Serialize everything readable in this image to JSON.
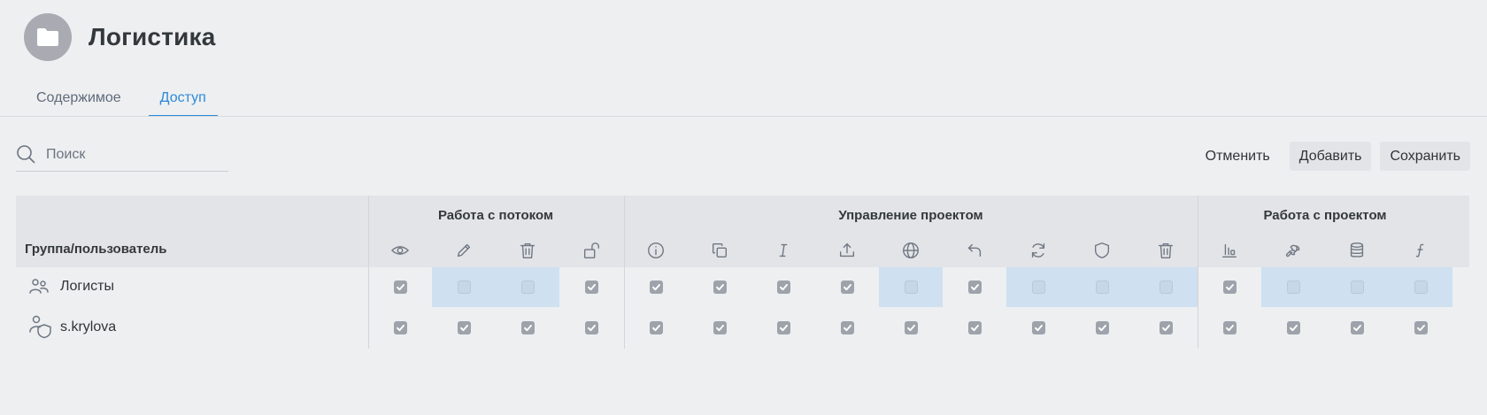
{
  "header": {
    "title": "Логистика",
    "icon": "folder-icon"
  },
  "tabs": [
    {
      "label": "Содержимое",
      "active": false
    },
    {
      "label": "Доступ",
      "active": true
    }
  ],
  "search": {
    "placeholder": "Поиск",
    "value": ""
  },
  "actions": {
    "cancel": "Отменить",
    "add": "Добавить",
    "save": "Сохранить"
  },
  "table": {
    "user_column": "Группа/пользователь",
    "groups": [
      {
        "title": "Работа с потоком",
        "icons": [
          "eye-icon",
          "pencil-icon",
          "trash-icon",
          "unlock-icon"
        ]
      },
      {
        "title": "Управление проектом",
        "icons": [
          "info-icon",
          "copy-icon",
          "italic-icon",
          "upload-icon",
          "globe-icon",
          "undo-icon",
          "refresh-icon",
          "shield-icon",
          "trash-icon"
        ]
      },
      {
        "title": "Работа с проектом",
        "icons": [
          "bar-chart-icon",
          "wrench-icon",
          "database-icon",
          "function-icon"
        ]
      }
    ],
    "rows": [
      {
        "name": "Логисты",
        "icon": "group-users-icon",
        "perms": [
          true,
          false,
          false,
          true,
          true,
          true,
          true,
          true,
          false,
          true,
          false,
          false,
          false,
          true,
          false,
          false,
          false
        ]
      },
      {
        "name": "s.krylova",
        "icon": "user-shield-icon",
        "perms": [
          true,
          true,
          true,
          true,
          true,
          true,
          true,
          true,
          true,
          true,
          true,
          true,
          true,
          true,
          true,
          true,
          true
        ]
      }
    ]
  },
  "colors": {
    "accent": "#2b8ad9",
    "highlight": "#cfe0f0",
    "header_bg": "#e3e4e8",
    "checkbox": "#9ea3ab"
  }
}
